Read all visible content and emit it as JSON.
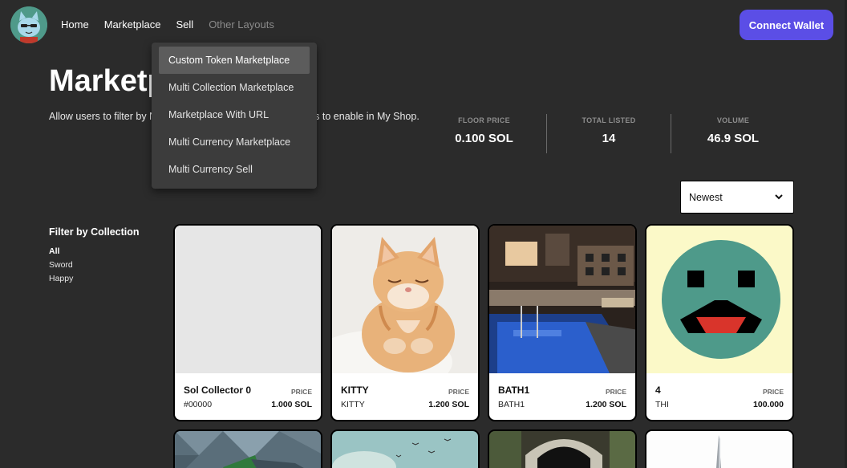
{
  "nav": {
    "items": [
      "Home",
      "Marketplace",
      "Sell",
      "Other Layouts"
    ],
    "connect_label": "Connect Wallet"
  },
  "dropdown": {
    "items": [
      "Custom Token Marketplace",
      "Multi Collection Marketplace",
      "Marketplace With URL",
      "Multi Currency Marketplace",
      "Multi Currency Sell"
    ]
  },
  "hero": {
    "title": "Marketplace",
    "description": "Allow users to filter by NFT collection. Choose the collections to enable in My Shop."
  },
  "stats": [
    {
      "label": "FLOOR PRICE",
      "value": "0.100 SOL"
    },
    {
      "label": "TOTAL LISTED",
      "value": "14"
    },
    {
      "label": "VOLUME",
      "value": "46.9 SOL"
    }
  ],
  "sort": {
    "selected": "Newest"
  },
  "filter": {
    "title": "Filter by Collection",
    "items": [
      "All",
      "Sword",
      "Happy"
    ]
  },
  "cards": [
    {
      "name": "Sol Collector 0",
      "sub": "#00000",
      "price_label": "PRICE",
      "price": "1.000 SOL"
    },
    {
      "name": "KITTY",
      "sub": "KITTY",
      "price_label": "PRICE",
      "price": "1.200 SOL"
    },
    {
      "name": "BATH1",
      "sub": "BATH1",
      "price_label": "PRICE",
      "price": "1.200 SOL"
    },
    {
      "name": "4",
      "sub": "THI",
      "price_label": "PRICE",
      "price": "100.000"
    }
  ],
  "colors": {
    "accent": "#5b4ee6",
    "background": "#2b2b2b"
  }
}
